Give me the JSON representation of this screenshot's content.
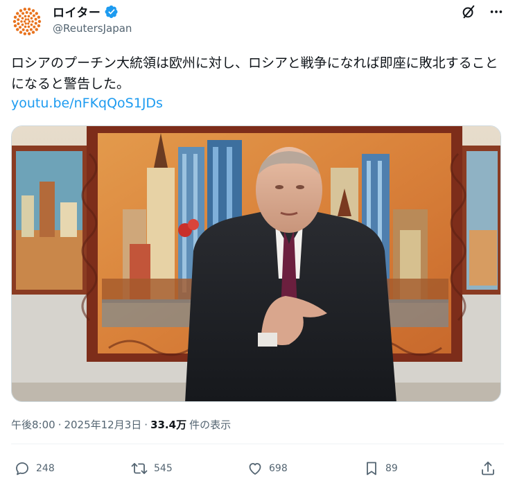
{
  "account": {
    "name": "ロイター",
    "handle": "@ReutersJapan",
    "avatar_icon": "reuters-logo-icon",
    "verified_icon": "verified-badge-icon"
  },
  "top_actions": {
    "grok_icon": "grok-icon",
    "more_icon": "more-icon"
  },
  "tweet": {
    "text": "ロシアのプーチン大統領は欧州に対し、ロシアと戦争になれば即座に敗北することになると警告した。",
    "link": "youtu.be/nFKqQoS1JDs"
  },
  "meta": {
    "time": "午後8:00",
    "dot1": "·",
    "date": "2025年12月3日",
    "dot2": "·",
    "views": "33.4万",
    "views_label": "件の表示"
  },
  "actions": {
    "reply_count": "248",
    "retweet_count": "545",
    "like_count": "698",
    "bookmark_count": "89"
  },
  "colors": {
    "link": "#1d9bf0",
    "verified": "#1d9bf0",
    "brand_orange": "#e8731e",
    "muted": "#536471"
  }
}
